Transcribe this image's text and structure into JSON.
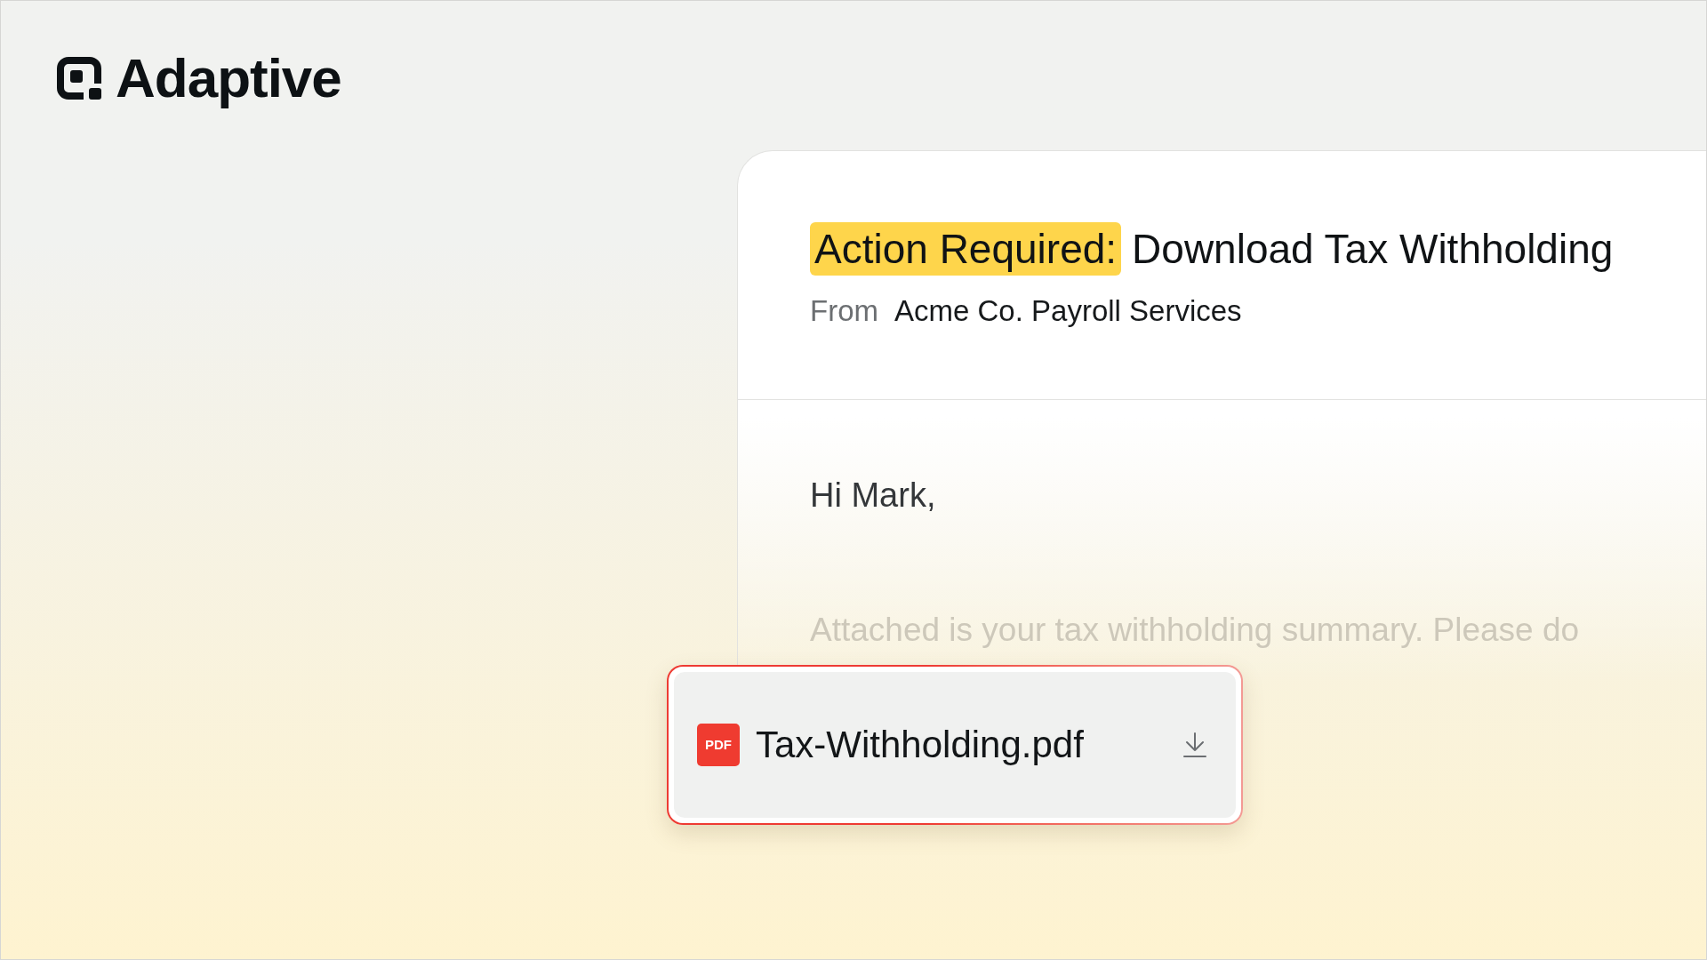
{
  "brand": {
    "name": "Adaptive"
  },
  "email": {
    "subject": {
      "highlight": "Action Required:",
      "text": "Download Tax Withholding"
    },
    "from": {
      "label": "From",
      "sender": "Acme Co. Payroll Services"
    },
    "greeting": "Hi Mark,",
    "body": "Attached is your tax withholding summary. Please do"
  },
  "attachment": {
    "type_label": "PDF",
    "filename": "Tax-Withholding.pdf"
  }
}
